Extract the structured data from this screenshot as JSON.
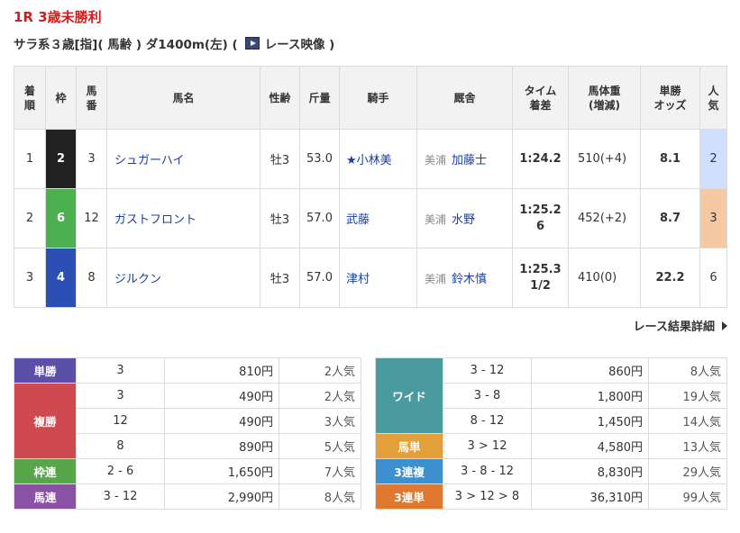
{
  "race": {
    "title": "1R 3歳未勝利",
    "subtitle_prefix": "サラ系３歳[指]( 馬齢 ) ダ1400m(左) (",
    "video_label": "レース映像 )"
  },
  "results_headers": [
    "着\n順",
    "枠",
    "馬\n番",
    "馬名",
    "性齢",
    "斤量",
    "騎手",
    "厩舎",
    "タイム\n着差",
    "馬体重\n(増減)",
    "単勝\nオッズ",
    "人\n気"
  ],
  "results": [
    {
      "rank": "1",
      "frame": "2",
      "number": "3",
      "horse": "シュガーハイ",
      "sex_age": "牡3",
      "weight_carried": "53.0",
      "jockey": "★小林美",
      "region": "美浦",
      "trainer": "加藤士",
      "time": "1:24.2",
      "margin": "",
      "body_weight": "510(+4)",
      "odds": "8.1",
      "popularity": "2"
    },
    {
      "rank": "2",
      "frame": "6",
      "number": "12",
      "horse": "ガストフロント",
      "sex_age": "牡3",
      "weight_carried": "57.0",
      "jockey": "武藤",
      "region": "美浦",
      "trainer": "水野",
      "time": "1:25.2",
      "margin": "6",
      "body_weight": "452(+2)",
      "odds": "8.7",
      "popularity": "3"
    },
    {
      "rank": "3",
      "frame": "4",
      "number": "8",
      "horse": "ジルクン",
      "sex_age": "牡3",
      "weight_carried": "57.0",
      "jockey": "津村",
      "region": "美浦",
      "trainer": "鈴木慎",
      "time": "1:25.3",
      "margin": "1/2",
      "body_weight": "410(0)",
      "odds": "22.2",
      "popularity": "6"
    }
  ],
  "detail_link": "レース結果詳細",
  "payouts_left": [
    {
      "type": "単勝",
      "color": "#5b4fa8",
      "rows": [
        {
          "combo": "3",
          "amount": "810円",
          "pop": "2人気"
        }
      ]
    },
    {
      "type": "複勝",
      "color": "#cf4a4f",
      "rows": [
        {
          "combo": "3",
          "amount": "490円",
          "pop": "2人気"
        },
        {
          "combo": "12",
          "amount": "490円",
          "pop": "3人気"
        },
        {
          "combo": "8",
          "amount": "890円",
          "pop": "5人気"
        }
      ]
    },
    {
      "type": "枠連",
      "color": "#58a64a",
      "rows": [
        {
          "combo": "2 - 6",
          "amount": "1,650円",
          "pop": "7人気"
        }
      ]
    },
    {
      "type": "馬連",
      "color": "#8a52a3",
      "rows": [
        {
          "combo": "3 - 12",
          "amount": "2,990円",
          "pop": "8人気"
        }
      ]
    }
  ],
  "payouts_right": [
    {
      "type": "ワイド",
      "color": "#4a9ba0",
      "rows": [
        {
          "combo": "3 - 12",
          "amount": "860円",
          "pop": "8人気"
        },
        {
          "combo": "3 - 8",
          "amount": "1,800円",
          "pop": "19人気"
        },
        {
          "combo": "8 - 12",
          "amount": "1,450円",
          "pop": "14人気"
        }
      ]
    },
    {
      "type": "馬単",
      "color": "#e3a03a",
      "rows": [
        {
          "combo": "3 > 12",
          "amount": "4,580円",
          "pop": "13人気"
        }
      ]
    },
    {
      "type": "3連複",
      "color": "#3d8fce",
      "rows": [
        {
          "combo": "3 - 8 - 12",
          "amount": "8,830円",
          "pop": "29人気"
        }
      ]
    },
    {
      "type": "3連単",
      "color": "#e0782f",
      "rows": [
        {
          "combo": "3 > 12 > 8",
          "amount": "36,310円",
          "pop": "99人気"
        }
      ]
    }
  ],
  "colors": {
    "frame_2": "#222222",
    "frame_6": "#4caf50",
    "frame_4": "#2b4fb5",
    "pop_first": "#cfe0ff",
    "pop_third": "#f5c9a4",
    "title_red": "#cc1f1f"
  },
  "icons": {
    "video": "video-icon",
    "detail_arrow": "chevron-right-icon"
  }
}
